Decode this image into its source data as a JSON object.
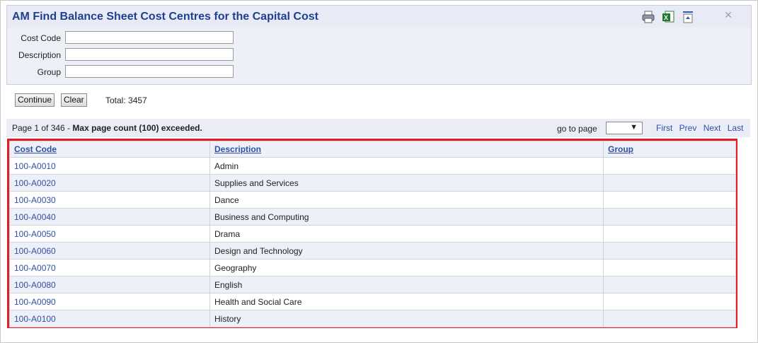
{
  "window": {
    "title": "AM Find Balance Sheet Cost Centres for the Capital Cost",
    "close_glyph": "✕"
  },
  "search": {
    "fields": [
      {
        "label": "Cost Code",
        "value": ""
      },
      {
        "label": "Description",
        "value": ""
      },
      {
        "label": "Group",
        "value": ""
      }
    ]
  },
  "actions": {
    "continue_label": "Continue",
    "clear_label": "Clear",
    "total_text": "Total: 3457"
  },
  "pager": {
    "page_text": "Page 1 of 346 - ",
    "warning_text": "Max page count (100) exceeded.",
    "goto_label": "go to page",
    "goto_value": "",
    "first_label": "First",
    "prev_label": "Prev",
    "next_label": "Next",
    "last_label": "Last"
  },
  "grid": {
    "columns": [
      "Cost Code",
      "Description",
      "Group"
    ],
    "rows": [
      {
        "code": "100-A0010",
        "description": "Admin",
        "group": ""
      },
      {
        "code": "100-A0020",
        "description": "Supplies and Services",
        "group": ""
      },
      {
        "code": "100-A0030",
        "description": "Dance",
        "group": ""
      },
      {
        "code": "100-A0040",
        "description": "Business and Computing",
        "group": ""
      },
      {
        "code": "100-A0050",
        "description": "Drama",
        "group": ""
      },
      {
        "code": "100-A0060",
        "description": "Design and Technology",
        "group": ""
      },
      {
        "code": "100-A0070",
        "description": "Geography",
        "group": ""
      },
      {
        "code": "100-A0080",
        "description": "English",
        "group": ""
      },
      {
        "code": "100-A0090",
        "description": "Health and Social Care",
        "group": ""
      },
      {
        "code": "100-A0100",
        "description": "History",
        "group": ""
      }
    ]
  },
  "colors": {
    "accent": "#1f3f8f",
    "link": "#2f4fa8",
    "highlight_border": "#e31b23"
  }
}
